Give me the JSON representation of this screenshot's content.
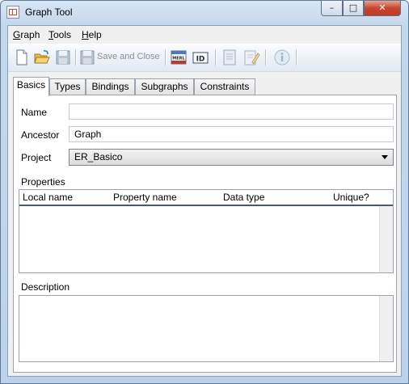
{
  "window": {
    "title": "Graph Tool",
    "minimize_glyph": "–",
    "maximize_glyph": "□",
    "close_glyph": "✕"
  },
  "menu": {
    "items": [
      {
        "label": "Graph",
        "mnemonic": "G",
        "rest": "raph"
      },
      {
        "label": "Tools",
        "mnemonic": "T",
        "rest": "ools"
      },
      {
        "label": "Help",
        "mnemonic": "H",
        "rest": "elp"
      }
    ]
  },
  "toolbar": {
    "save_and_close_label": "Save and Close",
    "merl_label": "MERL",
    "id_label": "ID",
    "icons": [
      "new-file-icon",
      "open-folder-icon",
      "save-icon",
      "save-and-close-icon",
      "merl-icon",
      "id-icon",
      "document-icon",
      "edit-icon",
      "info-icon"
    ]
  },
  "tabs": [
    "Basics",
    "Types",
    "Bindings",
    "Subgraphs",
    "Constraints"
  ],
  "active_tab": "Basics",
  "form": {
    "name_label": "Name",
    "name_value": "",
    "ancestor_label": "Ancestor",
    "ancestor_value": "Graph",
    "project_label": "Project",
    "project_value": "ER_Basico",
    "properties_label": "Properties",
    "properties_columns": [
      "Local name",
      "Property name",
      "Data type",
      "Unique?"
    ],
    "description_label": "Description",
    "description_value": ""
  }
}
